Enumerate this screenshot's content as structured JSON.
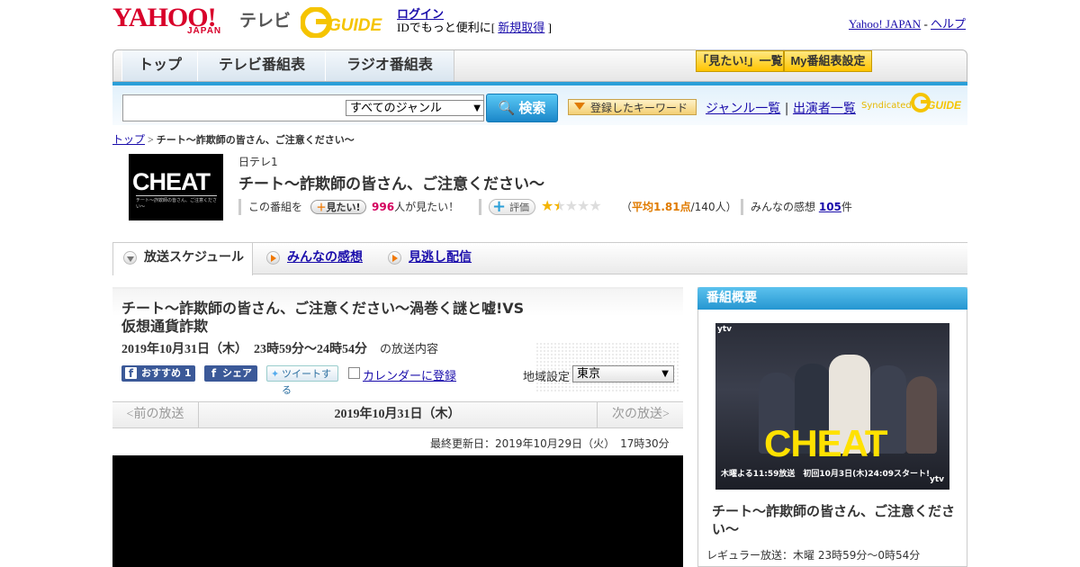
{
  "header": {
    "yahoo_logo": "YAHOO!",
    "japan_logo": "JAPAN",
    "tv_label": "テレビ",
    "gguide_logo": "G-GUIDE",
    "login_link": "ログイン",
    "id_prefix": "IDでもっと便利に[ ",
    "signup_link": "新規取得",
    "id_suffix": " ]",
    "yahoo_japan_link": "Yahoo! JAPAN",
    "separator": " - ",
    "help_link": "ヘルプ"
  },
  "nav": {
    "tabs": [
      "トップ",
      "テレビ番組表",
      "ラジオ番組表"
    ],
    "mitai_list": "「見たい!」一覧",
    "my_schedule": "My番組表設定"
  },
  "search": {
    "genre_selected": "すべてのジャンル",
    "search_button": "検索",
    "keyword_button": "登録したキーワード",
    "genre_list": "ジャンル一覧",
    "divider": "|",
    "cast_list": "出演者一覧",
    "syndicated": "Syndicated",
    "gguide_small": "G-GUIDE"
  },
  "breadcrumb": {
    "top": "トップ",
    "sep": " > ",
    "current": "チート～詐欺師の皆さん、ご注意ください～"
  },
  "program": {
    "thumb_title": "CHEAT",
    "thumb_sub": "チート～詐欺師の皆さん、ご注意ください～",
    "channel": "日テレ1",
    "title": "チート～詐欺師の皆さん、ご注意ください～",
    "mitai_prefix": "この番組を",
    "mitai_button": "見たい!",
    "mitai_count": "996",
    "mitai_suffix": "人が見たい！",
    "rating_button": "評価",
    "rating_stars": 1.5,
    "rating_prefix": "（",
    "rating_avg": "平均1.81点",
    "rating_count": "/140人）",
    "comments_prefix": "みんなの感想",
    "comments_count": "105",
    "comments_suffix": "件"
  },
  "subtabs": {
    "schedule": "放送スケジュール",
    "reviews": "みんなの感想",
    "missed": "見逃し配信"
  },
  "episode": {
    "title": "チート～詐欺師の皆さん、ご注意ください～渦巻く謎と嘘!VS仮想通貨詐欺",
    "date": "2019年10月31日（木）　23時59分～24時54分",
    "date_suffix": "の放送内容",
    "fb_recommend": "おすすめ 1",
    "fb_share": "シェア",
    "tweet": "ツイートする",
    "calendar": "カレンダーに登録",
    "region_label": "地域設定",
    "region_selected": "東京",
    "prev": "<前の放送",
    "current_date": "2019年10月31日（木）",
    "next": "次の放送>",
    "updated": "最終更新日：2019年10月29日（火）　17時30分"
  },
  "sidebar": {
    "heading": "番組概要",
    "poster_logo_top": "ytv",
    "poster_title": "CHEAT",
    "poster_airtime": "木曜よる11:59放送　初回10月3日(木)24:09スタート!",
    "poster_logo_bottom": "ytv",
    "title": "チート～詐欺師の皆さん、ご注意ください～",
    "regular": "レギュラー放送：木曜 23時59分～0時54分"
  },
  "colors": {
    "yahoo_red": "#d8002a",
    "accent_blue": "#2a9fd8",
    "link": "#1a0dab",
    "pink_count": "#d4005e",
    "orange_rating": "#e07b00"
  }
}
